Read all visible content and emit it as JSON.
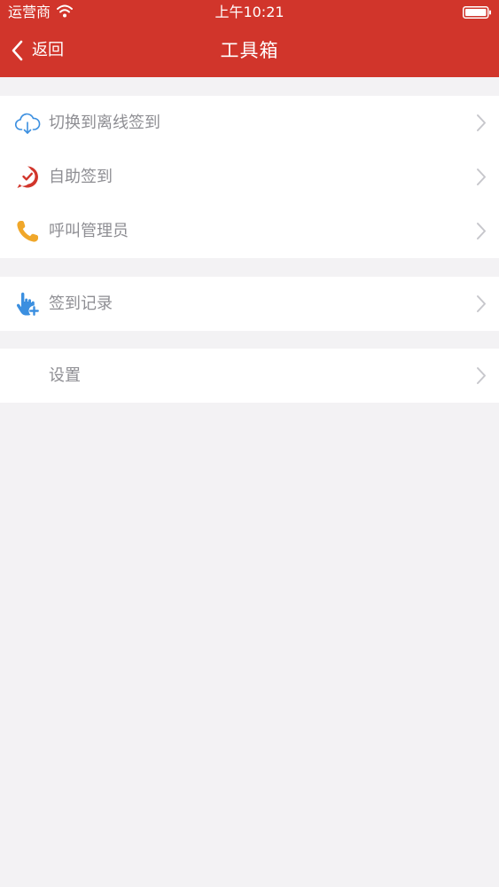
{
  "status_bar": {
    "carrier": "运营商",
    "time": "上午10:21"
  },
  "nav": {
    "back_label": "返回",
    "title": "工具箱"
  },
  "colors": {
    "header_bg": "#d1352b",
    "page_bg": "#f3f2f4",
    "label_gray": "#8e8e93",
    "icon_blue": "#3b8fe0",
    "icon_red": "#d1352b",
    "icon_orange": "#f0a72a"
  },
  "menu": {
    "groups": [
      {
        "items": [
          {
            "label": "切换到离线签到",
            "icon": "cloud-download-icon"
          },
          {
            "label": "自助签到",
            "icon": "check-pin-icon"
          },
          {
            "label": "呼叫管理员",
            "icon": "phone-icon"
          }
        ]
      },
      {
        "items": [
          {
            "label": "签到记录",
            "icon": "hand-pointer-plus-icon"
          }
        ]
      },
      {
        "items": [
          {
            "label": "设置",
            "icon": ""
          }
        ]
      }
    ]
  }
}
